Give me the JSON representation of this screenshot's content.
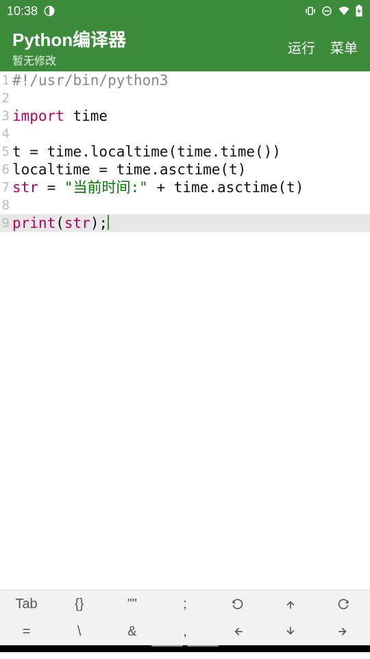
{
  "statusbar": {
    "time": "10:38"
  },
  "appbar": {
    "title": "Python编译器",
    "subtitle": "暂无修改",
    "run": "运行",
    "menu": "菜单"
  },
  "code": {
    "lines": [
      {
        "n": 1,
        "tokens": [
          {
            "cls": "tok-comment",
            "t": "#!/usr/bin/python3"
          }
        ]
      },
      {
        "n": 2,
        "tokens": []
      },
      {
        "n": 3,
        "tokens": [
          {
            "cls": "tok-keyword",
            "t": "import"
          },
          {
            "cls": "tok-default",
            "t": " time"
          }
        ]
      },
      {
        "n": 4,
        "tokens": []
      },
      {
        "n": 5,
        "tokens": [
          {
            "cls": "tok-default",
            "t": "t = time.localtime(time.time())"
          }
        ]
      },
      {
        "n": 6,
        "tokens": [
          {
            "cls": "tok-default",
            "t": "localtime = time.asctime(t)"
          }
        ]
      },
      {
        "n": 7,
        "tokens": [
          {
            "cls": "tok-builtin",
            "t": "str"
          },
          {
            "cls": "tok-default",
            "t": " = "
          },
          {
            "cls": "tok-string",
            "t": "\"当前时间:\""
          },
          {
            "cls": "tok-default",
            "t": " + time.asctime(t)"
          }
        ]
      },
      {
        "n": 8,
        "tokens": []
      },
      {
        "n": 9,
        "current": true,
        "cursor": true,
        "tokens": [
          {
            "cls": "tok-builtin",
            "t": "print"
          },
          {
            "cls": "tok-default",
            "t": "("
          },
          {
            "cls": "tok-builtin",
            "t": "str"
          },
          {
            "cls": "tok-default",
            "t": ");"
          }
        ]
      }
    ]
  },
  "toolbar": {
    "row1": [
      "Tab",
      "{}",
      "\"\"",
      ";",
      "↺",
      "⇧",
      "↻"
    ],
    "row2": [
      "=",
      "\\",
      "&",
      ",",
      "⇦",
      "⇩",
      "⇨"
    ]
  }
}
